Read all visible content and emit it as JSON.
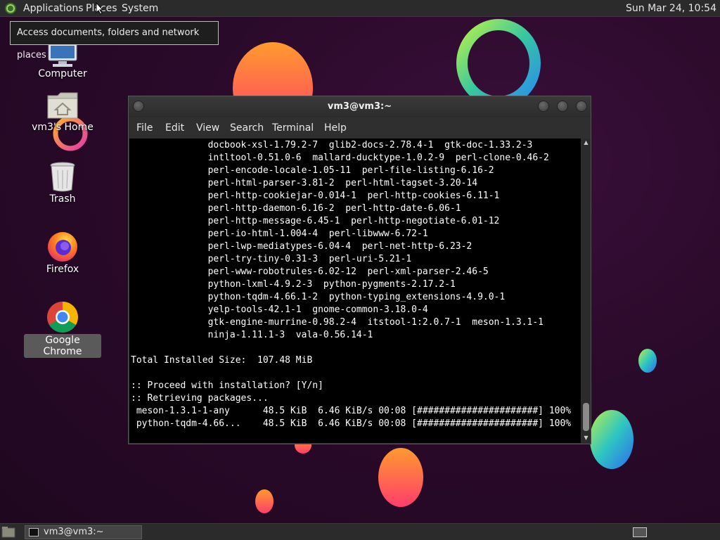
{
  "panel": {
    "menus": [
      "Applications",
      "Places",
      "System"
    ],
    "clock": "Sun Mar 24, 10:54"
  },
  "tooltip": "Access documents, folders and network places",
  "desktop_icons": [
    {
      "label": "Computer",
      "icon": "computer-icon"
    },
    {
      "label": "vm3's Home",
      "icon": "home-folder-icon"
    },
    {
      "label": "Trash",
      "icon": "trash-icon"
    },
    {
      "label": "Firefox",
      "icon": "firefox-icon"
    },
    {
      "label": "Google Chrome",
      "icon": "chrome-icon",
      "selected": true
    }
  ],
  "terminal": {
    "title": "vm3@vm3:~",
    "menus": [
      "File",
      "Edit",
      "View",
      "Search",
      "Terminal",
      "Help"
    ],
    "lines": [
      "              docbook-xsl-1.79.2-7  glib2-docs-2.78.4-1  gtk-doc-1.33.2-3",
      "              intltool-0.51.0-6  mallard-ducktype-1.0.2-9  perl-clone-0.46-2",
      "              perl-encode-locale-1.05-11  perl-file-listing-6.16-2",
      "              perl-html-parser-3.81-2  perl-html-tagset-3.20-14",
      "              perl-http-cookiejar-0.014-1  perl-http-cookies-6.11-1",
      "              perl-http-daemon-6.16-2  perl-http-date-6.06-1",
      "              perl-http-message-6.45-1  perl-http-negotiate-6.01-12",
      "              perl-io-html-1.004-4  perl-libwww-6.72-1",
      "              perl-lwp-mediatypes-6.04-4  perl-net-http-6.23-2",
      "              perl-try-tiny-0.31-3  perl-uri-5.21-1",
      "              perl-www-robotrules-6.02-12  perl-xml-parser-2.46-5",
      "              python-lxml-4.9.2-3  python-pygments-2.17.2-1",
      "              python-tqdm-4.66.1-2  python-typing_extensions-4.9.0-1",
      "              yelp-tools-42.1-1  gnome-common-3.18.0-4",
      "              gtk-engine-murrine-0.98.2-4  itstool-1:2.0.7-1  meson-1.3.1-1",
      "              ninja-1.11.1-3  vala-0.56.14-1",
      "",
      "Total Installed Size:  107.48 MiB",
      "",
      ":: Proceed with installation? [Y/n]",
      ":: Retrieving packages...",
      " meson-1.3.1-1-any      48.5 KiB  6.46 KiB/s 00:08 [######################] 100%",
      " python-tqdm-4.66...    48.5 KiB  6.46 KiB/s 00:08 [######################] 100%"
    ]
  },
  "taskbar": {
    "window_button": "vm3@vm3:~"
  },
  "colors": {
    "background": "#2a0a2a",
    "panel": "#2b2b2b",
    "terminal_bg": "#000000"
  }
}
